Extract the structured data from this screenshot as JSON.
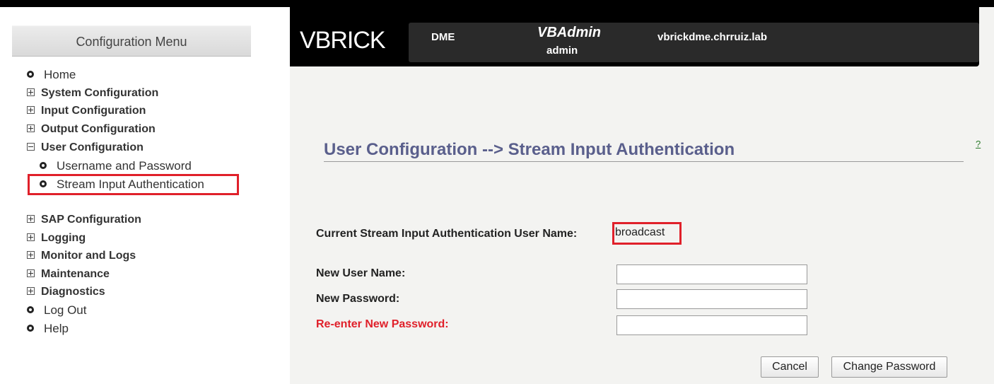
{
  "sidebar": {
    "header": "Configuration Menu",
    "items": [
      {
        "label": "Home"
      },
      {
        "label": "System Configuration"
      },
      {
        "label": "Input Configuration"
      },
      {
        "label": "Output Configuration"
      },
      {
        "label": "User Configuration"
      },
      {
        "label": "Username and Password"
      },
      {
        "label": "Stream Input Authentication"
      },
      {
        "label": "SAP Configuration"
      },
      {
        "label": "Logging"
      },
      {
        "label": "Monitor and Logs"
      },
      {
        "label": "Maintenance"
      },
      {
        "label": "Diagnostics"
      },
      {
        "label": "Log Out"
      },
      {
        "label": "Help"
      }
    ]
  },
  "header": {
    "logo": "VBRICK",
    "product": "DME",
    "app": "VBAdmin",
    "user": "admin",
    "host": "vbrickdme.chrruiz.lab"
  },
  "main": {
    "title": "User Configuration --> Stream Input Authentication",
    "help": "?",
    "current_label": "Current Stream Input Authentication User Name:",
    "current_value": "broadcast",
    "new_user_label": "New User Name:",
    "new_password_label": "New Password:",
    "reenter_label": "Re-enter New Password:",
    "new_user_value": "",
    "new_password_value": "",
    "reenter_value": "",
    "cancel_label": "Cancel",
    "change_label": "Change Password"
  },
  "colors": {
    "title": "#5a5f8c",
    "highlight": "#e0202a",
    "required_label": "#e0202a",
    "help_link": "#2b7a2b"
  }
}
